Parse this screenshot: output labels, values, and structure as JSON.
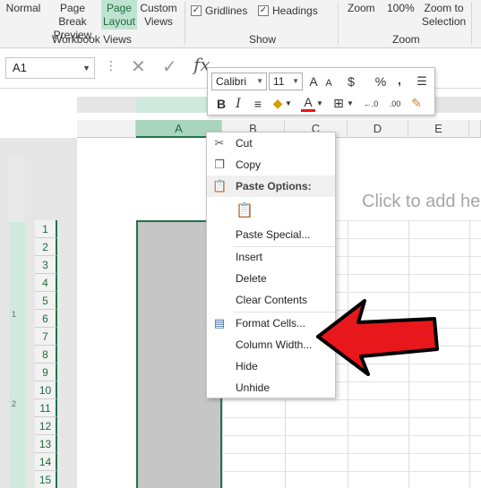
{
  "ribbon": {
    "buttons": {
      "normal": "Normal",
      "page_break_1": "Page Break",
      "page_break_2": "Preview",
      "page_layout_1": "Page",
      "page_layout_2": "Layout",
      "custom_views_1": "Custom",
      "custom_views_2": "Views",
      "zoom": "Zoom",
      "zoom_100": "100%",
      "zoom_selection_1": "Zoom to",
      "zoom_selection_2": "Selection"
    },
    "show": {
      "gridlines": "Gridlines",
      "headings": "Headings"
    },
    "groups": {
      "workbook_views": "Workbook Views",
      "show": "Show",
      "zoom": "Zoom"
    }
  },
  "formula_bar": {
    "name_box": "A1",
    "cancel_glyph": "✕",
    "enter_glyph": "✓",
    "fx_glyph": "fx"
  },
  "mini_toolbar": {
    "font_name": "Calibri",
    "font_size": "11",
    "grow_glyph": "A",
    "shrink_glyph": "A",
    "currency_glyph": "$",
    "percent_glyph": "%",
    "comma_glyph": ",",
    "bold": "B",
    "italic": "I",
    "font_color_glyph": "A",
    "inc_decimal": "←.0",
    "dec_decimal": ".00"
  },
  "sheet": {
    "columns": [
      "A",
      "B",
      "C",
      "D",
      "E"
    ],
    "rows": [
      "1",
      "2",
      "3",
      "4",
      "5",
      "6",
      "7",
      "8",
      "9",
      "10",
      "11",
      "12",
      "13",
      "14",
      "15"
    ],
    "header_hint": "Click to add he",
    "ruler_marks": [
      "1",
      "2"
    ]
  },
  "context_menu": {
    "cut": "Cut",
    "copy": "Copy",
    "paste_options": "Paste Options:",
    "paste_special": "Paste Special...",
    "insert": "Insert",
    "delete": "Delete",
    "clear_contents": "Clear Contents",
    "format_cells": "Format Cells...",
    "column_width": "Column Width...",
    "hide": "Hide",
    "unhide": "Unhide"
  },
  "colors": {
    "accent": "#217346",
    "selected_header": "#a9d5be",
    "arrow": "#e8171c"
  }
}
